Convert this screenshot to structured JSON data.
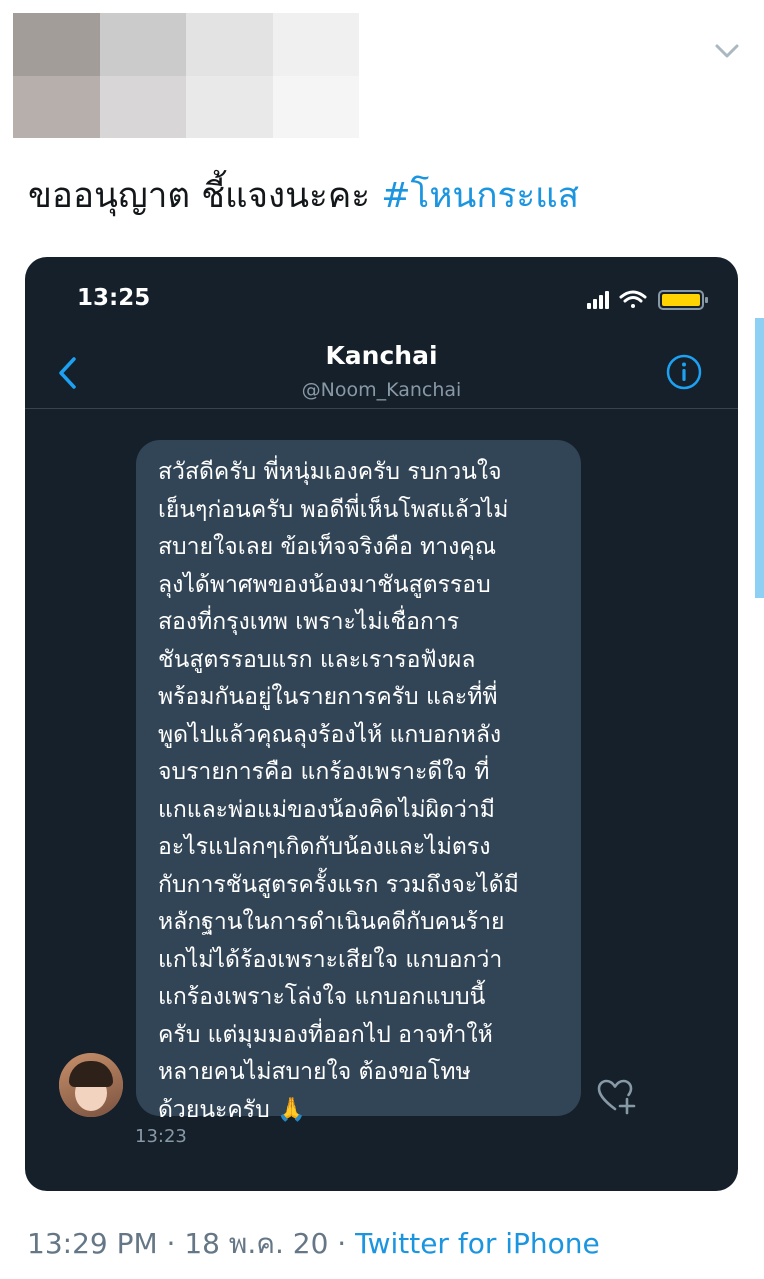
{
  "tweet": {
    "text": "ขออนุญาต ชี้แจงนะคะ ",
    "hashtag": "#โหนกระแส",
    "menu_icon": "chevron-down-icon"
  },
  "colors": {
    "link": "#1b95e0",
    "dm_background": "#15202b",
    "bubble": "#324556",
    "muted": "#8899a6"
  },
  "screenshot": {
    "status_time": "13:25",
    "contact_name": "Kanchai",
    "contact_handle": "@Noom_Kanchai",
    "message_lines": [
      "สวัสดีครับ พี่หนุ่มเองครับ รบกวนใจ",
      "เย็นๆก่อนครับ พอดีพี่เห็นโพสแล้วไม่",
      "สบายใจเลย ข้อเท็จจริงคือ ทางคุณ",
      "ลุงได้พาศพของน้องมาชันสูตรรอบ",
      "สองที่กรุงเทพ เพราะไม่เชื่อการ",
      "ชันสูตรรอบแรก และเรารอฟังผล",
      "พร้อมกันอยู่ในรายการครับ และที่พี่",
      "พูดไปแล้วคุณลุงร้องไห้ แกบอกหลัง",
      "จบรายการคือ แกร้องเพราะดีใจ ที่",
      "แกและพ่อแม่ของน้องคิดไม่ผิดว่ามี",
      "อะไรแปลกๆเกิดกับน้องและไม่ตรง",
      "กับการชันสูตรครั้งแรก รวมถึงจะได้มี",
      "หลักฐานในการดำเนินคดีกับคนร้าย",
      "แกไม่ได้ร้องเพราะเสียใจ แกบอกว่า",
      "แกร้องเพราะโล่งใจ แกบอกแบบนี้",
      "ครับ แต่มุมมองที่ออกไป อาจทำให้",
      "หลายคนไม่สบายใจ ต้องขอโทษ",
      "ด้วยนะครับ 🙏"
    ],
    "message_time": "13:23"
  },
  "footer": {
    "timestamp": "13:29 PM · 18 พ.ค. 20 · ",
    "source": "Twitter for iPhone"
  }
}
